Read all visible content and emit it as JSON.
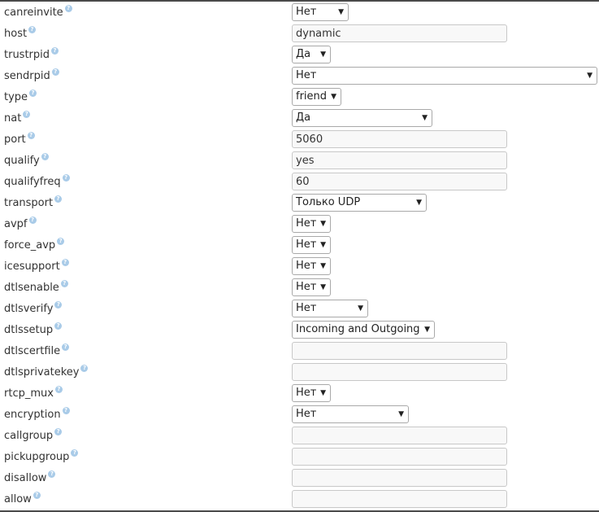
{
  "help_glyph": "?",
  "rows": [
    {
      "label": "canreinvite",
      "kind": "select",
      "value": "Нет",
      "w": 70
    },
    {
      "label": "host",
      "kind": "input",
      "value": "dynamic"
    },
    {
      "label": "trustrpid",
      "kind": "select",
      "value": "Да",
      "w": 48
    },
    {
      "label": "sendrpid",
      "kind": "select",
      "value": "Нет",
      "w": 376
    },
    {
      "label": "type",
      "kind": "select",
      "value": "friend",
      "w": 61
    },
    {
      "label": "nat",
      "kind": "select",
      "value": "Да",
      "w": 173
    },
    {
      "label": "port",
      "kind": "input",
      "value": "5060"
    },
    {
      "label": "qualify",
      "kind": "input",
      "value": "yes"
    },
    {
      "label": "qualifyfreq",
      "kind": "input",
      "value": "60"
    },
    {
      "label": "transport",
      "kind": "select",
      "value": "Только UDP",
      "w": 166
    },
    {
      "label": "avpf",
      "kind": "select",
      "value": "Нет",
      "w": 48
    },
    {
      "label": "force_avp",
      "kind": "select",
      "value": "Нет",
      "w": 48
    },
    {
      "label": "icesupport",
      "kind": "select",
      "value": "Нет",
      "w": 48
    },
    {
      "label": "dtlsenable",
      "kind": "select",
      "value": "Нет",
      "w": 48
    },
    {
      "label": "dtlsverify",
      "kind": "select",
      "value": "Нет",
      "w": 94
    },
    {
      "label": "dtlssetup",
      "kind": "select",
      "value": "Incoming and Outgoing",
      "w": 176
    },
    {
      "label": "dtlscertfile",
      "kind": "input",
      "value": ""
    },
    {
      "label": "dtlsprivatekey",
      "kind": "input",
      "value": ""
    },
    {
      "label": "rtcp_mux",
      "kind": "select",
      "value": "Нет",
      "w": 48
    },
    {
      "label": "encryption",
      "kind": "select",
      "value": "Нет",
      "w": 144
    },
    {
      "label": "callgroup",
      "kind": "input",
      "value": ""
    },
    {
      "label": "pickupgroup",
      "kind": "input",
      "value": ""
    },
    {
      "label": "disallow",
      "kind": "input",
      "value": ""
    },
    {
      "label": "allow",
      "kind": "input",
      "value": ""
    }
  ]
}
